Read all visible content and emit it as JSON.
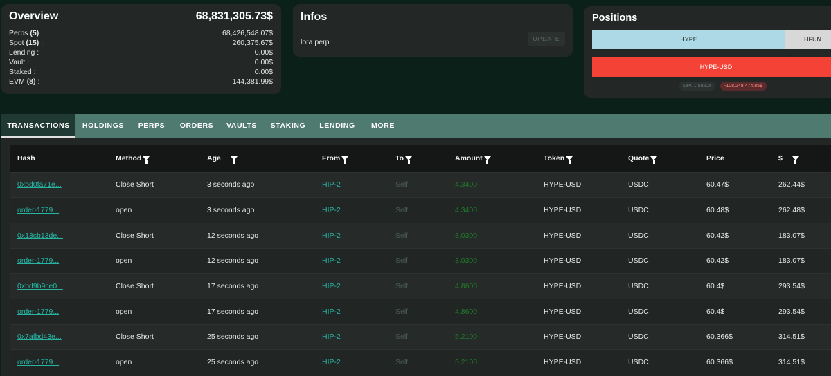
{
  "overview": {
    "title": "Overview",
    "total": "68,831,305.73$",
    "rows": [
      {
        "label": "Perps",
        "count": "(5)",
        "suffix": " :",
        "value": "68,426,548.07$"
      },
      {
        "label": "Spot",
        "count": "(15)",
        "suffix": " :",
        "value": "260,375.67$"
      },
      {
        "label": "Lending :",
        "count": "",
        "suffix": "",
        "value": "0.00$"
      },
      {
        "label": "Vault :",
        "count": "",
        "suffix": "",
        "value": "0.00$"
      },
      {
        "label": "Staked :",
        "count": "",
        "suffix": "",
        "value": "0.00$"
      },
      {
        "label": "EVM",
        "count": "(8)",
        "suffix": " :",
        "value": "144,381.99$"
      }
    ]
  },
  "infos": {
    "title": "Infos",
    "description": "lora perp",
    "update_label": "UPDATE"
  },
  "positions": {
    "title": "Positions",
    "tabs": [
      "HYPE",
      "HFUN"
    ],
    "bar_label": "HYPE-USD",
    "leverage": "Lev. 1.5820x",
    "pnl": "-108,248,474.85$",
    "colors": {
      "selected": "#add8e6",
      "bar": "#f44336"
    }
  },
  "tabs": [
    "TRANSACTIONS",
    "HOLDINGS",
    "PERPS",
    "ORDERS",
    "VAULTS",
    "STAKING",
    "LENDING",
    "MORE"
  ],
  "table": {
    "columns": [
      "Hash",
      "Method",
      "Age",
      "From",
      "To",
      "Amount",
      "Token",
      "Quote",
      "Price",
      "$"
    ],
    "rows": [
      {
        "hash": "0xbd0fa71e...",
        "method": "Close Short",
        "age": "3 seconds ago",
        "from": "HIP-2",
        "to": "Self",
        "amount": "4.3400",
        "token": "HYPE-USD",
        "quote": "USDC",
        "price": "60.47$",
        "usd": "262.44$"
      },
      {
        "hash": "order-1779...",
        "method": "open",
        "age": "3 seconds ago",
        "from": "HIP-2",
        "to": "Self",
        "amount": "4.3400",
        "token": "HYPE-USD",
        "quote": "USDC",
        "price": "60.48$",
        "usd": "262.48$"
      },
      {
        "hash": "0x13cb13de...",
        "method": "Close Short",
        "age": "12 seconds ago",
        "from": "HIP-2",
        "to": "Self",
        "amount": "3.0300",
        "token": "HYPE-USD",
        "quote": "USDC",
        "price": "60.42$",
        "usd": "183.07$"
      },
      {
        "hash": "order-1779...",
        "method": "open",
        "age": "12 seconds ago",
        "from": "HIP-2",
        "to": "Self",
        "amount": "3.0300",
        "token": "HYPE-USD",
        "quote": "USDC",
        "price": "60.42$",
        "usd": "183.07$"
      },
      {
        "hash": "0xbd9b9ce0...",
        "method": "Close Short",
        "age": "17 seconds ago",
        "from": "HIP-2",
        "to": "Self",
        "amount": "4.8600",
        "token": "HYPE-USD",
        "quote": "USDC",
        "price": "60.4$",
        "usd": "293.54$"
      },
      {
        "hash": "order-1779...",
        "method": "open",
        "age": "17 seconds ago",
        "from": "HIP-2",
        "to": "Self",
        "amount": "4.8600",
        "token": "HYPE-USD",
        "quote": "USDC",
        "price": "60.4$",
        "usd": "293.54$"
      },
      {
        "hash": "0x7afbd43e...",
        "method": "Close Short",
        "age": "25 seconds ago",
        "from": "HIP-2",
        "to": "Self",
        "amount": "5.2100",
        "token": "HYPE-USD",
        "quote": "USDC",
        "price": "60.366$",
        "usd": "314.51$"
      },
      {
        "hash": "order-1779...",
        "method": "open",
        "age": "25 seconds ago",
        "from": "HIP-2",
        "to": "Self",
        "amount": "5.2100",
        "token": "HYPE-USD",
        "quote": "USDC",
        "price": "60.366$",
        "usd": "314.51$"
      }
    ]
  }
}
